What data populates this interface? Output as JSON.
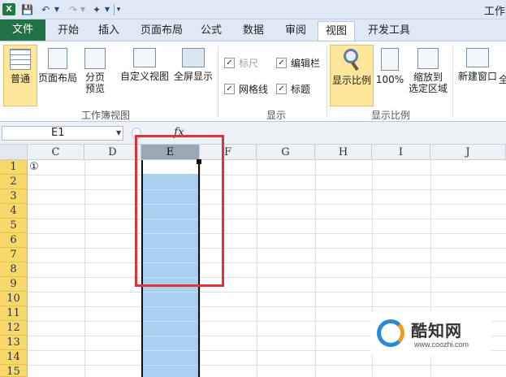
{
  "window": {
    "title_partial": "工作"
  },
  "tabs": [
    {
      "label": "文件"
    },
    {
      "label": "开始"
    },
    {
      "label": "插入"
    },
    {
      "label": "页面布局"
    },
    {
      "label": "公式"
    },
    {
      "label": "数据"
    },
    {
      "label": "审阅"
    },
    {
      "label": "视图"
    },
    {
      "label": "开发工具"
    }
  ],
  "ribbon": {
    "workbook_views": {
      "group_label": "工作簿视图",
      "normal": "普通",
      "page_layout": "页面布局",
      "page_break_line1": "分页",
      "page_break_line2": "预览",
      "custom_views": "自定义视图",
      "full_screen": "全屏显示"
    },
    "show": {
      "group_label": "显示",
      "ruler": "标尺",
      "ruler_checked": true,
      "formula_bar": "编辑栏",
      "formula_bar_checked": true,
      "gridlines": "网格线",
      "gridlines_checked": true,
      "headings": "标题",
      "headings_checked": true
    },
    "zoom": {
      "group_label": "显示比例",
      "zoom": "显示比例",
      "zoom_100": "100%",
      "zoom_selection_line1": "缩放到",
      "zoom_selection_line2": "选定区域"
    },
    "window": {
      "new_window": "新建窗口"
    }
  },
  "formula_bar": {
    "name_box": "E1",
    "fx": "fx"
  },
  "grid": {
    "columns": [
      "C",
      "D",
      "E",
      "F",
      "G",
      "H",
      "I",
      "J"
    ],
    "selected_column": "E",
    "rows": [
      "1",
      "2",
      "3",
      "4",
      "5",
      "6",
      "7",
      "8",
      "9",
      "10",
      "11",
      "12",
      "13",
      "14",
      "15"
    ],
    "cell_C1": "①"
  },
  "watermark": {
    "title": "酷知网",
    "url": "www.coozhi.com"
  }
}
